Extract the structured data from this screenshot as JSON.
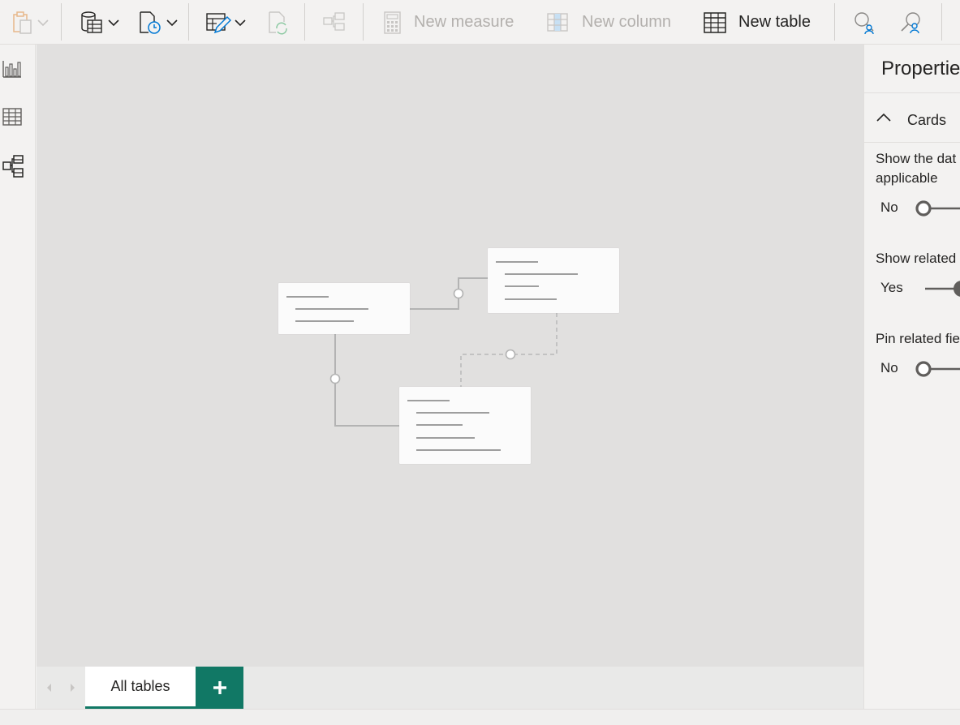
{
  "toolbar": {
    "new_measure_label": "New measure",
    "new_column_label": "New column",
    "new_table_label": "New table"
  },
  "tabs": {
    "all_tables_label": "All tables",
    "add_tab_glyph": "+"
  },
  "properties": {
    "title": "Propertie",
    "section_label": "Cards",
    "show_database_line1": "Show the dat",
    "show_database_line2": "applicable",
    "show_database_value": "No",
    "show_related_label": "Show related",
    "show_related_value": "Yes",
    "pin_related_label": "Pin related fie",
    "pin_related_value": "No"
  },
  "colors": {
    "accent": "#117865",
    "canvas": "#e1e0df",
    "disabled_text": "#b3b0ad",
    "toggle": "#605e5c"
  },
  "icons": {
    "paste": "paste-icon",
    "get_data": "database-table-icon",
    "recent_sources": "recent-sources-icon",
    "transform_data": "transform-data-icon",
    "refresh": "refresh-icon",
    "manage_relationships": "manage-relationships-icon",
    "new_measure": "calculator-icon",
    "new_column": "new-column-icon",
    "new_table": "table-icon",
    "view_as": "view-as-icon",
    "manage_roles": "manage-roles-icon",
    "report_view": "bar-chart-icon",
    "data_view": "grid-icon",
    "model_view": "model-icon"
  }
}
